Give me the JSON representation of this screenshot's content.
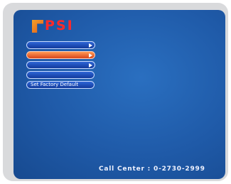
{
  "brand": {
    "name": "PSI",
    "tagline": ""
  },
  "menu": {
    "items": [
      {
        "label": "",
        "has_arrow": true,
        "active": false
      },
      {
        "label": "",
        "has_arrow": true,
        "active": true
      },
      {
        "label": "",
        "has_arrow": true,
        "active": false
      },
      {
        "label": "",
        "has_arrow": false,
        "active": false
      },
      {
        "label": "Set Factory Default",
        "has_arrow": false,
        "active": false
      }
    ]
  },
  "footer": {
    "call_center": "Call Center : 0-2730-2999"
  },
  "colors": {
    "screen": "#1f5aa8",
    "menu_button": "#1c4bb8",
    "menu_active": "#ee6a2e",
    "logo_text": "#ff2a2a"
  }
}
